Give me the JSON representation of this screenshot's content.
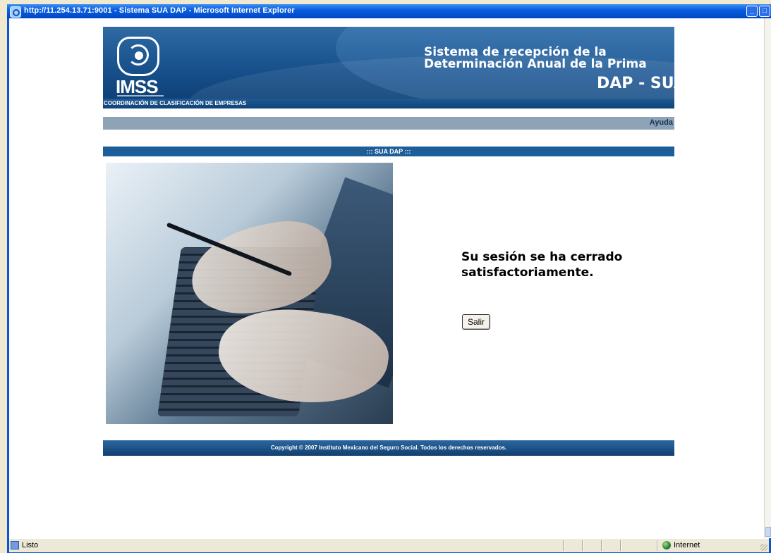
{
  "window": {
    "title": "http://11.254.13.71:9001 - Sistema SUA DAP - Microsoft Internet Explorer"
  },
  "header": {
    "logo_text": "IMSS",
    "title_line1": "Sistema de recepción de la",
    "title_line2": "Determinación Anual de la Prima",
    "subtitle": "DAP - SUA",
    "coordination": "COORDINACIÓN DE CLASIFICACIÓN DE EMPRESAS"
  },
  "nav": {
    "help_label": "Ayuda"
  },
  "section": {
    "title": "::: SUA DAP :::"
  },
  "main": {
    "message": "Su sesión se ha cerrado satisfactoriamente.",
    "exit_button_label": "Salir"
  },
  "footer": {
    "copyright": "Copyright © 2007 Instituto Mexicano del Seguro Social. Todos los derechos reservados."
  },
  "statusbar": {
    "status_text": "Listo",
    "zone_text": "Internet"
  },
  "colors": {
    "banner_blue": "#164f8a",
    "help_bar_gray": "#8ea3b6",
    "section_blue": "#1d5d98"
  }
}
